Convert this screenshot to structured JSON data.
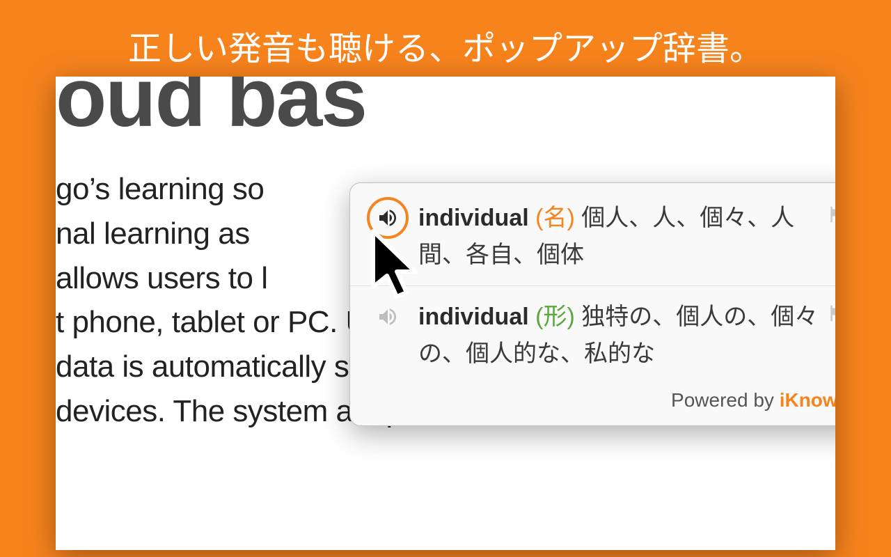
{
  "headline": "正しい発音も聴ける、ポップアップ辞書。",
  "doc": {
    "title": "oud bas",
    "body": "go's learning so\nnal learning as\nallows users to l\nt phone, tablet or PC. Users' individual\ndata is automatically synched across all\ndevices. The system adapts to an individual"
  },
  "popup": {
    "entries": [
      {
        "word": "individual",
        "pos": "(名)",
        "pos_class": "pos-noun",
        "meanings": "個人、人、個々、人間、各自、個体",
        "active": true
      },
      {
        "word": "individual",
        "pos": "(形)",
        "pos_class": "pos-adj",
        "meanings": "独特の、個人の、個々の、個人的な、私的な",
        "active": false
      }
    ],
    "powered_label": "Powered by ",
    "powered_brand": "iKnow!"
  },
  "colors": {
    "accent": "#f7831d",
    "adj": "#5aa83c"
  }
}
